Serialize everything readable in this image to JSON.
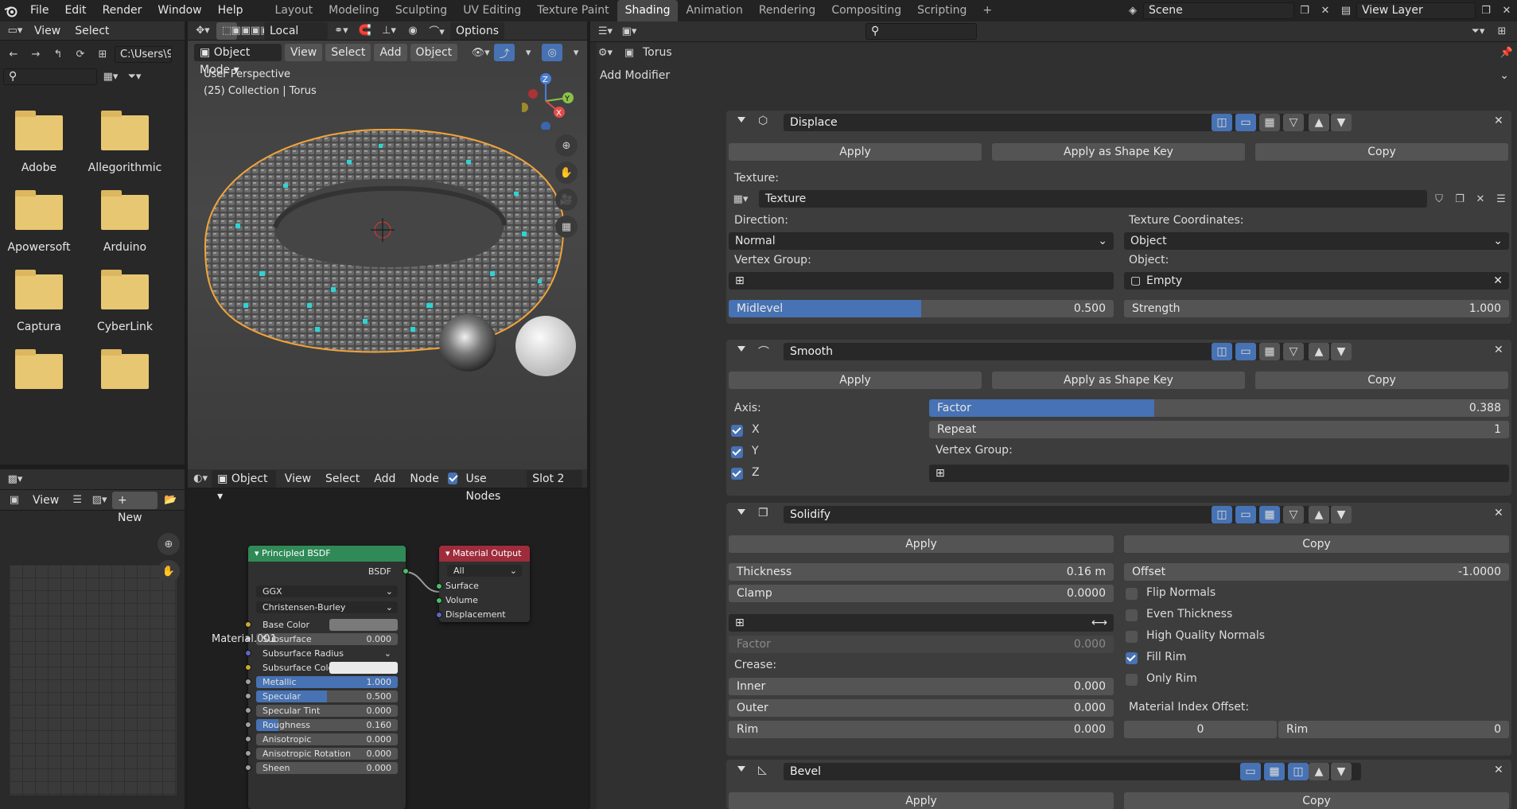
{
  "topbar": {
    "menus": [
      "File",
      "Edit",
      "Render",
      "Window",
      "Help"
    ],
    "workspaces": [
      "Layout",
      "Modeling",
      "Sculpting",
      "UV Editing",
      "Texture Paint",
      "Shading",
      "Animation",
      "Rendering",
      "Compositing",
      "Scripting"
    ],
    "active_workspace": "Shading",
    "scene": "Scene",
    "view_layer": "View Layer"
  },
  "filebrowser": {
    "view_label": "View",
    "select_label": "Select",
    "path": "C:\\Users\\9...",
    "folders": [
      "Adobe",
      "Allegorithmic",
      "Apowersoft",
      "Arduino",
      "Captura",
      "CyberLink",
      "",
      ""
    ]
  },
  "viewport": {
    "orientation": "Local",
    "options": "Options",
    "mode": "Object Mode",
    "menu_view": "View",
    "menu_select": "Select",
    "menu_add": "Add",
    "menu_object": "Object",
    "info_line1": "User Perspective",
    "info_line2": "(25) Collection | Torus",
    "gizmo_z": "Z",
    "gizmo_y": "Y",
    "gizmo_x": "X"
  },
  "imgeditor": {
    "view": "View",
    "new": "New"
  },
  "nodeeditor": {
    "object": "Object",
    "view": "View",
    "select": "Select",
    "add": "Add",
    "node": "Node",
    "use_nodes": "Use Nodes",
    "slot": "Slot 2",
    "material_name": "Material.001",
    "bsdf": {
      "title": "Principled BSDF",
      "output": "BSDF",
      "distribution": "GGX",
      "subsurface_method": "Christensen-Burley",
      "inputs": [
        {
          "label": "Base Color",
          "kind": "color",
          "color": "#7a7a7a",
          "sock": "#c7a93a"
        },
        {
          "label": "Subsurface",
          "value": "0.000",
          "fill": 0,
          "sock": "#a1a1a1"
        },
        {
          "label": "Subsurface Radius",
          "kind": "select",
          "sock": "#6363c7"
        },
        {
          "label": "Subsurface Color",
          "kind": "color",
          "color": "#eaeaea",
          "sock": "#c7a93a"
        },
        {
          "label": "Metallic",
          "value": "1.000",
          "fill": 1,
          "sock": "#a1a1a1"
        },
        {
          "label": "Specular",
          "value": "0.500",
          "fill": 0.5,
          "sock": "#a1a1a1"
        },
        {
          "label": "Specular Tint",
          "value": "0.000",
          "fill": 0,
          "sock": "#a1a1a1"
        },
        {
          "label": "Roughness",
          "value": "0.160",
          "fill": 0.16,
          "sock": "#a1a1a1"
        },
        {
          "label": "Anisotropic",
          "value": "0.000",
          "fill": 0,
          "sock": "#a1a1a1"
        },
        {
          "label": "Anisotropic Rotation",
          "value": "0.000",
          "fill": 0,
          "sock": "#a1a1a1"
        },
        {
          "label": "Sheen",
          "value": "0.000",
          "fill": 0,
          "sock": "#a1a1a1"
        }
      ]
    },
    "output": {
      "title": "Material Output",
      "target": "All",
      "inputs": [
        "Surface",
        "Volume",
        "Displacement"
      ]
    }
  },
  "properties": {
    "object_name": "Torus",
    "add_modifier": "Add Modifier",
    "apply": "Apply",
    "apply_shape": "Apply as Shape Key",
    "copy": "Copy",
    "displace": {
      "name": "Displace",
      "texture_label": "Texture:",
      "texture": "Texture",
      "direction_label": "Direction:",
      "direction": "Normal",
      "coords_label": "Texture Coordinates:",
      "coords": "Object",
      "vgroup_label": "Vertex Group:",
      "object_label": "Object:",
      "object": "Empty",
      "midlevel_label": "Midlevel",
      "midlevel": "0.500",
      "midlevel_fill": 0.5,
      "strength_label": "Strength",
      "strength": "1.000"
    },
    "smooth": {
      "name": "Smooth",
      "axis_label": "Axis:",
      "x": "X",
      "y": "Y",
      "z": "Z",
      "factor_label": "Factor",
      "factor": "0.388",
      "factor_fill": 0.388,
      "repeat_label": "Repeat",
      "repeat": "1",
      "vgroup_label": "Vertex Group:"
    },
    "solidify": {
      "name": "Solidify",
      "thickness_label": "Thickness",
      "thickness": "0.16 m",
      "offset_label": "Offset",
      "offset": "-1.0000",
      "clamp_label": "Clamp",
      "clamp": "0.0000",
      "factor_label": "Factor",
      "factor": "0.000",
      "flip": "Flip Normals",
      "even": "Even Thickness",
      "hq": "High Quality Normals",
      "fill_rim": "Fill Rim",
      "only_rim": "Only Rim",
      "crease_label": "Crease:",
      "inner_label": "Inner",
      "inner": "0.000",
      "outer_label": "Outer",
      "outer": "0.000",
      "rim_label": "Rim",
      "rim": "0.000",
      "mat_offset_label": "Material Index Offset:",
      "mat_offset": "0",
      "mat_rim_label": "Rim",
      "mat_rim": "0"
    },
    "bevel": {
      "name": "Bevel"
    }
  },
  "colors": {
    "accent": "#4772b3",
    "active_tab": "#474747",
    "panel": "#3d3d3d",
    "node_green": "#2f8a57",
    "node_red": "#9e2c3b"
  }
}
